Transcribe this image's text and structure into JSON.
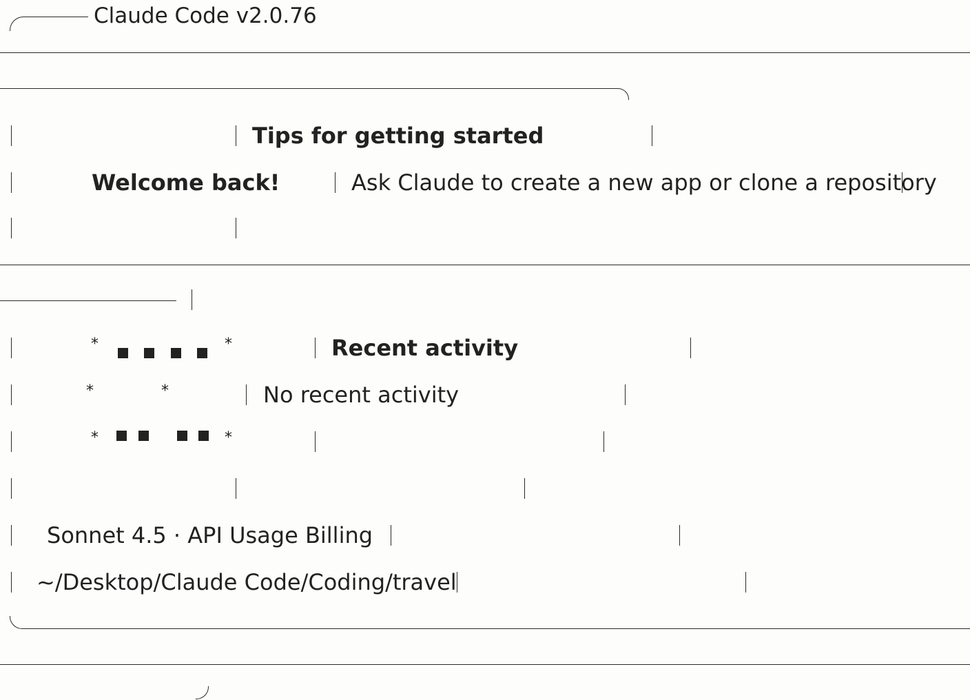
{
  "app": {
    "title": "Claude Code v2.0.76"
  },
  "welcome": {
    "heading": "Welcome back!",
    "model_line": "Sonnet 4.5 · API Usage Billing",
    "path": "~/Desktop/Claude Code/Coding/travel"
  },
  "tips": {
    "heading": "Tips for getting started",
    "body": "Ask Claude to create a new app or clone a repository"
  },
  "activity": {
    "heading": "Recent activity",
    "body": "No recent activity"
  },
  "logo": {
    "star": "*",
    "icon_name": "claude-pixel-logo-icon"
  },
  "colors": {
    "background": "#fdfdfb",
    "text": "#222222",
    "border": "#2a2a2a"
  }
}
